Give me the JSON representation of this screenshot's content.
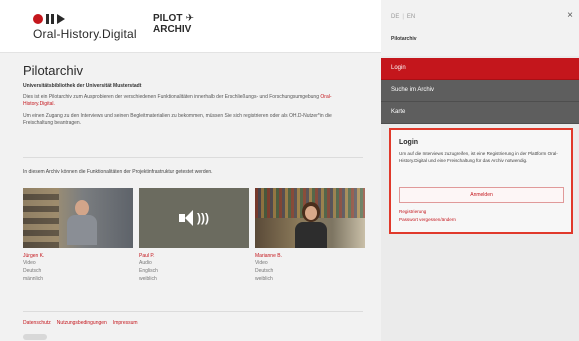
{
  "header": {
    "logo_text": "Oral-History.Digital",
    "pilot_line1": "PILOT",
    "pilot_line2": "ARCHIV",
    "plane_glyph": "✈"
  },
  "main": {
    "title": "Pilotarchiv",
    "org_name": "Universitätsbibliothek der Universität Musterstadt",
    "intro_text": "Dies ist ein Pilotarchiv zum Ausprobieren der verschiedenen Funktionalitäten innerhalb der Erschließungs- und Forschungsumgebung",
    "intro_link": "Oral-History.Digital.",
    "access_text": "Um einen Zugang zu den Interviews und seinen Begleitmaterialien zu bekommen, müssen Sie sich registrieren oder als OH.D-Nutzer*in die Freischaltung beantragen.",
    "functions_text": "In diesem Archiv können die Funktionalitäten der Projektinfrastruktur getestet werden.",
    "cards": [
      {
        "name": "Jürgen K.",
        "type": "Video",
        "language": "Deutsch",
        "gender": "männlich"
      },
      {
        "name": "Paul P.",
        "type": "Audio",
        "language": "Englisch",
        "gender": "weiblich"
      },
      {
        "name": "Marianne B.",
        "type": "Video",
        "language": "Deutsch",
        "gender": "weiblich"
      }
    ],
    "footer_links": [
      "Datenschutz",
      "Nutzungsbedingungen",
      "Impressum"
    ]
  },
  "panel": {
    "lang_de": "DE",
    "lang_en": "EN",
    "close_glyph": "×",
    "title": "Pilotarchiv",
    "menu": [
      "Login",
      "Suche im Archiv",
      "Karte"
    ],
    "login": {
      "title": "Login",
      "text": "Um auf die Interviews zuzugreifen, ist eine Registrierung in der Plattform Oral-History.Digital und eine Freischaltung für das Archiv notwendig.",
      "button": "Anmelden",
      "register_link": "Registrierung",
      "password_link": "Passwort vergessen/ändern"
    }
  }
}
